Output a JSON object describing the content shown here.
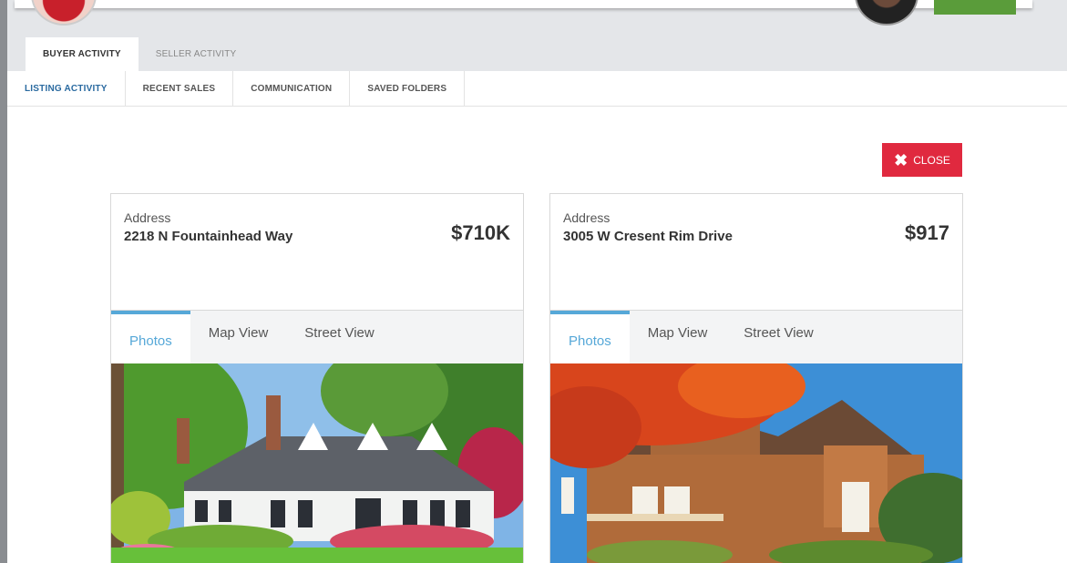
{
  "tabs_top": [
    "BUYER ACTIVITY",
    "SELLER ACTIVITY"
  ],
  "subnav": [
    "LISTING ACTIVITY",
    "RECENT SALES",
    "COMMUNICATION",
    "SAVED FOLDERS"
  ],
  "close_label": "CLOSE",
  "view_tabs": [
    "Photos",
    "Map View",
    "Street View"
  ],
  "listings": [
    {
      "address_label": "Address",
      "address": "2218 N Fountainhead Way",
      "price": "$710K"
    },
    {
      "address_label": "Address",
      "address": "3005 W Cresent Rim Drive",
      "price": "$917"
    }
  ],
  "colors": {
    "accent_blue": "#56a8d8",
    "close_red": "#e0293f",
    "active_subnav": "#2a6aa0"
  },
  "icons": [
    "close-icon"
  ]
}
